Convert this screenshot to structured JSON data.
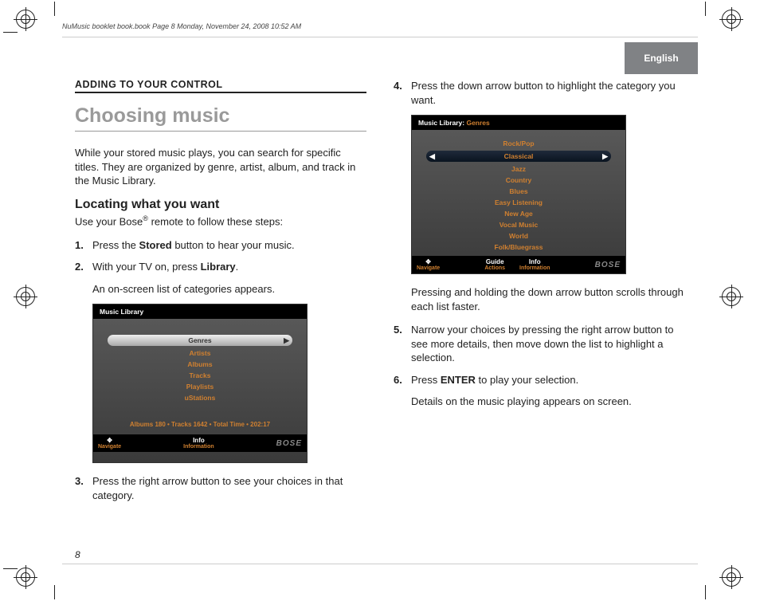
{
  "header_line": "NuMusic booklet book.book  Page 8  Monday, November 24, 2008  10:52 AM",
  "language_tab": "English",
  "section_label": "ADDING TO YOUR CONTROL",
  "page_number": "8",
  "left": {
    "title": "Choosing music",
    "intro": "While your stored music plays, you can search for specific titles. They are organized by genre, artist, album, and track in the Music Library.",
    "subhead": "Locating what you want",
    "sublead_prefix": "Use your Bose",
    "sublead_suffix": " remote to follow these steps:",
    "steps": {
      "s1": {
        "num": "1.",
        "pre": "Press the ",
        "bold": "Stored",
        "post": " button to hear your music."
      },
      "s2": {
        "num": "2.",
        "pre": "With your TV on, press ",
        "bold": "Library",
        "post": ".",
        "sub": "An on-screen list of categories appears."
      },
      "s3": {
        "num": "3.",
        "text": "Press the right arrow button to see your choices in that category."
      }
    },
    "screen1": {
      "title": "Music Library",
      "selected": "Genres",
      "rows": [
        "Artists",
        "Albums",
        "Tracks",
        "Playlists",
        "uStations"
      ],
      "stats": "Albums 180 • Tracks 1642 • Total Time • 202:17",
      "footer": {
        "nav_glyph": "✥",
        "nav": "Navigate",
        "info_glyph": "Info",
        "info": "Information",
        "brand": "BOSE"
      }
    }
  },
  "right": {
    "steps": {
      "s4": {
        "num": "4.",
        "text": "Press the down arrow button to highlight the category you want."
      },
      "after4": "Pressing and holding the down arrow button scrolls through each list faster.",
      "s5": {
        "num": "5.",
        "text": "Narrow your choices by pressing the right arrow button to see more details, then move down the list to highlight a selection."
      },
      "s6": {
        "num": "6.",
        "pre": "Press ",
        "bold": "ENTER",
        "post": " to play your selection.",
        "sub": "Details on the music playing appears on screen."
      }
    },
    "screen2": {
      "title_prefix": "Music Library: ",
      "title_suffix": "Genres",
      "rows_before": [
        "Rock/Pop"
      ],
      "selected": "Classical",
      "rows_after": [
        "Jazz",
        "Country",
        "Blues",
        "Easy Listening",
        "New Age",
        "Vocal Music",
        "World",
        "Folk/Bluegrass"
      ],
      "footer": {
        "nav_glyph": "✥",
        "nav": "Navigate",
        "act_glyph": "Guide",
        "act": "Actions",
        "info_glyph": "Info",
        "info": "Information",
        "brand": "BOSE"
      }
    }
  }
}
